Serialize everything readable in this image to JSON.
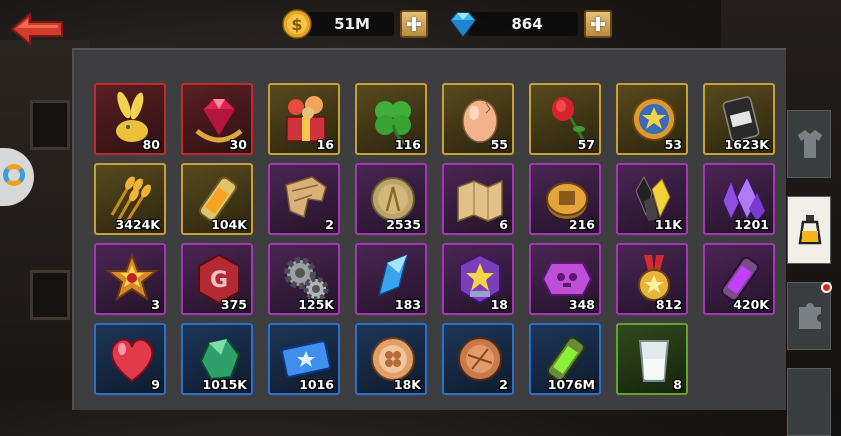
{
  "topbar": {
    "coins": {
      "icon": "gold-coin-icon",
      "value": "51M"
    },
    "gems": {
      "icon": "diamond-icon",
      "value": "864"
    }
  },
  "inventory": {
    "items": [
      {
        "icon": "rabbit-charm-icon",
        "count": "80",
        "rarity": "red"
      },
      {
        "icon": "ruby-gem-icon",
        "count": "30",
        "rarity": "red"
      },
      {
        "icon": "gift-box-icon",
        "count": "16",
        "rarity": "gold"
      },
      {
        "icon": "clover-icon",
        "count": "116",
        "rarity": "gold"
      },
      {
        "icon": "egg-icon",
        "count": "55",
        "rarity": "gold"
      },
      {
        "icon": "rose-icon",
        "count": "57",
        "rarity": "gold"
      },
      {
        "icon": "star-medal-icon",
        "count": "53",
        "rarity": "gold"
      },
      {
        "icon": "oil-barrel-icon",
        "count": "1623K",
        "rarity": "gold"
      },
      {
        "icon": "wheat-icon",
        "count": "3424K",
        "rarity": "gold"
      },
      {
        "icon": "fuel-tube-icon",
        "count": "104K",
        "rarity": "gold"
      },
      {
        "icon": "map-fragment-icon",
        "count": "2",
        "rarity": "purple"
      },
      {
        "icon": "wheat-coin-icon",
        "count": "2535",
        "rarity": "purple"
      },
      {
        "icon": "treasure-map-icon",
        "count": "6",
        "rarity": "purple"
      },
      {
        "icon": "coin-token-icon",
        "count": "216",
        "rarity": "purple"
      },
      {
        "icon": "crystal-shard-icon",
        "count": "11K",
        "rarity": "purple"
      },
      {
        "icon": "purple-crystal-icon",
        "count": "1201",
        "rarity": "purple"
      },
      {
        "icon": "star-badge-icon",
        "count": "3",
        "rarity": "purple"
      },
      {
        "icon": "g-token-icon",
        "count": "375",
        "rarity": "purple"
      },
      {
        "icon": "gears-icon",
        "count": "125K",
        "rarity": "purple"
      },
      {
        "icon": "blue-crystal-icon",
        "count": "183",
        "rarity": "purple"
      },
      {
        "icon": "star-emblem-icon",
        "count": "18",
        "rarity": "purple"
      },
      {
        "icon": "purple-skull-gem-icon",
        "count": "348",
        "rarity": "purple"
      },
      {
        "icon": "medal-icon",
        "count": "812",
        "rarity": "purple"
      },
      {
        "icon": "purple-tube-icon",
        "count": "420K",
        "rarity": "purple"
      },
      {
        "icon": "heart-icon",
        "count": "9",
        "rarity": "blue"
      },
      {
        "icon": "green-ore-icon",
        "count": "1015K",
        "rarity": "blue"
      },
      {
        "icon": "blue-ticket-icon",
        "count": "1016",
        "rarity": "blue"
      },
      {
        "icon": "clover-chip-icon",
        "count": "18K",
        "rarity": "blue"
      },
      {
        "icon": "bronze-chip-icon",
        "count": "2",
        "rarity": "blue"
      },
      {
        "icon": "green-tube-icon",
        "count": "1076M",
        "rarity": "blue"
      },
      {
        "icon": "glass-cup-icon",
        "count": "8",
        "rarity": "green"
      }
    ]
  },
  "side_tabs": [
    {
      "icon": "shirt-icon",
      "active": false
    },
    {
      "icon": "potion-icon",
      "active": true
    },
    {
      "icon": "puzzle-icon",
      "active": false
    }
  ],
  "colors": {
    "red": "#c4282b",
    "gold": "#c9a036",
    "purple": "#a437b4",
    "blue": "#2b6fcf",
    "green": "#63a42c"
  }
}
